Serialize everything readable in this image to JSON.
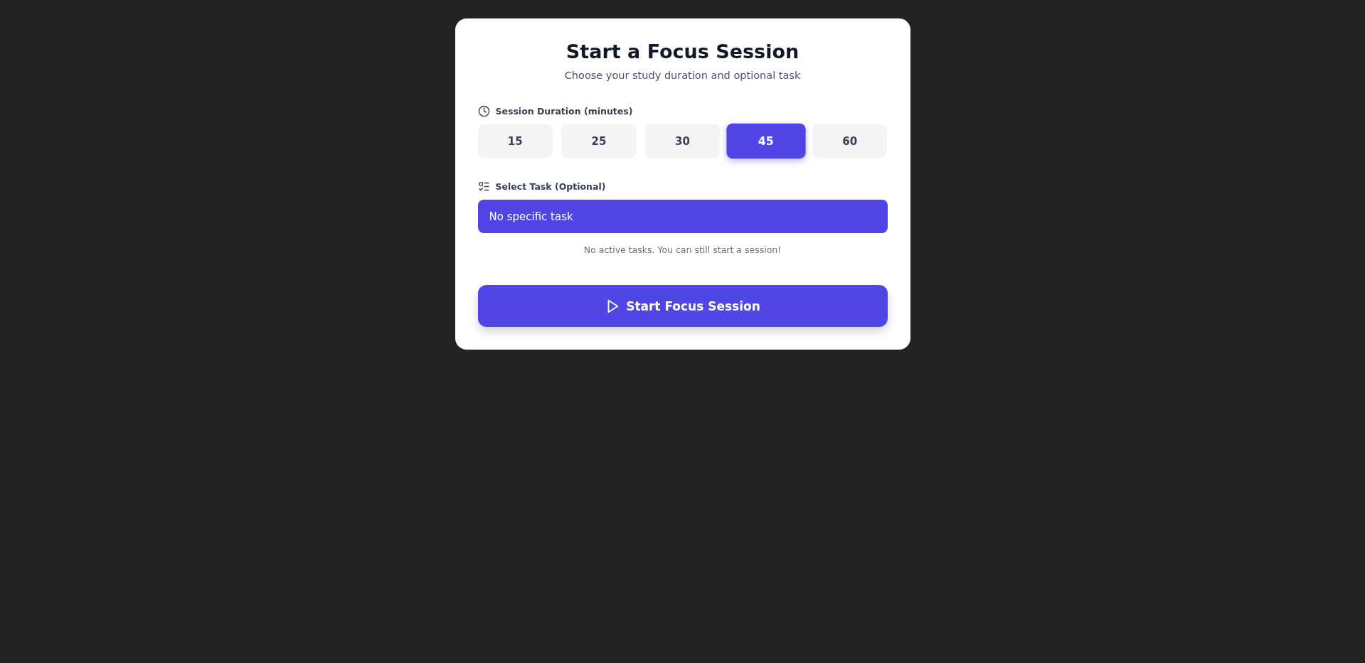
{
  "card": {
    "title": "Start a Focus Session",
    "subtitle": "Choose your study duration and optional task",
    "duration": {
      "label": "Session Duration (minutes)",
      "options": [
        {
          "label": "15",
          "selected": false
        },
        {
          "label": "25",
          "selected": false
        },
        {
          "label": "30",
          "selected": false
        },
        {
          "label": "45",
          "selected": true
        },
        {
          "label": "60",
          "selected": false
        }
      ]
    },
    "task": {
      "label": "Select Task (Optional)",
      "value": "No specific task",
      "hint": "No active tasks. You can still start a session!"
    },
    "start_button": {
      "label": "Start Focus Session"
    }
  }
}
